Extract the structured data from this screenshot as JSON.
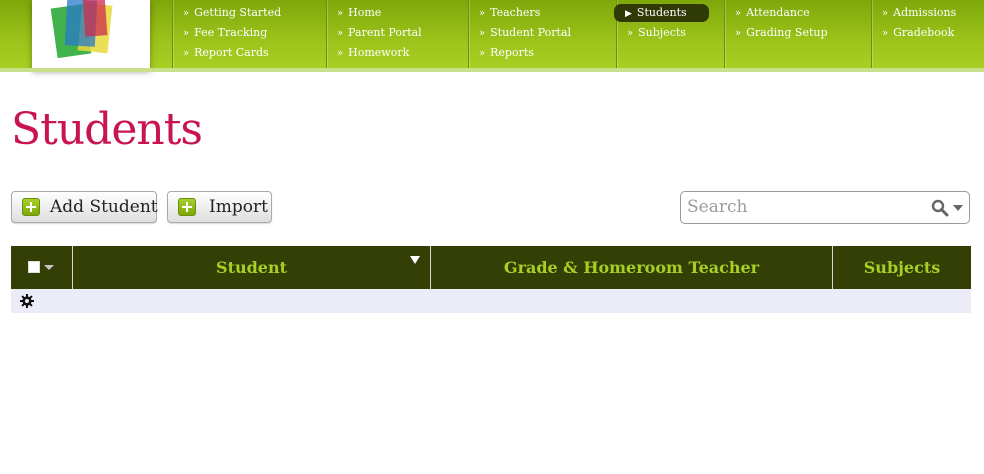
{
  "nav": {
    "columns": [
      {
        "links": [
          "Getting Started",
          "Fee Tracking",
          "Report Cards"
        ]
      },
      {
        "links": [
          "Home",
          "Parent Portal",
          "Homework"
        ]
      },
      {
        "links": [
          "Teachers",
          "Student Portal",
          "Reports"
        ]
      },
      {
        "links": [
          "Students",
          "Subjects"
        ],
        "active": "Students"
      },
      {
        "links": [
          "Attendance",
          "Grading Setup"
        ]
      },
      {
        "links": [
          "Admissions",
          "Gradebook"
        ]
      }
    ],
    "bullet": "»",
    "active_bullet": "▶"
  },
  "page": {
    "title": "Students"
  },
  "toolbar": {
    "add_label": "Add Student",
    "import_label": "Import"
  },
  "search": {
    "placeholder": "Search",
    "value": ""
  },
  "table": {
    "columns": [
      "Student",
      "Grade & Homeroom Teacher",
      "Subjects"
    ],
    "rows": []
  },
  "colors": {
    "brand_green": "#9cc31a",
    "header_dark": "#333f05",
    "header_text": "#a9cf24",
    "title_pink": "#c8144f",
    "row_bg": "#ececf9"
  },
  "icons": [
    "plus-icon",
    "search-icon",
    "chevron-down-icon",
    "gear-icon",
    "sort-desc-icon",
    "logo-icon"
  ]
}
